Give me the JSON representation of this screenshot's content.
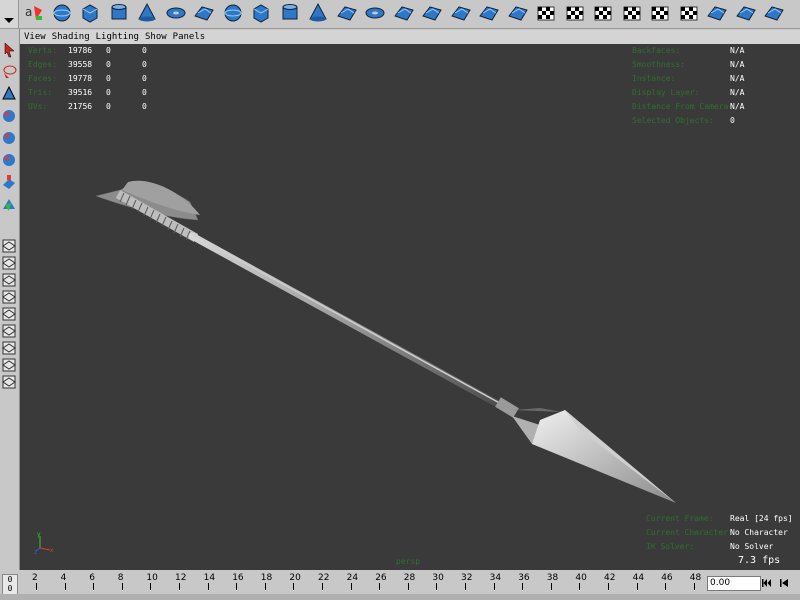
{
  "panel_menu": {
    "items": [
      "View",
      "Shading",
      "Lighting",
      "Show",
      "Panels"
    ]
  },
  "hud_left": [
    {
      "label": "Verts:",
      "v1": "19786",
      "v2": "0",
      "v3": "0"
    },
    {
      "label": "Edges:",
      "v1": "39558",
      "v2": "0",
      "v3": "0"
    },
    {
      "label": "Faces:",
      "v1": "19778",
      "v2": "0",
      "v3": "0"
    },
    {
      "label": "Tris:",
      "v1": "39516",
      "v2": "0",
      "v3": "0"
    },
    {
      "label": "UVs:",
      "v1": "21756",
      "v2": "0",
      "v3": "0"
    }
  ],
  "hud_right": [
    {
      "label": "Backfaces:",
      "value": "N/A"
    },
    {
      "label": "Smoothness:",
      "value": "N/A"
    },
    {
      "label": "Instance:",
      "value": "N/A"
    },
    {
      "label": "Display Layer:",
      "value": "N/A"
    },
    {
      "label": "Distance From Camera:",
      "value": "N/A"
    },
    {
      "label": "Selected Objects:",
      "value": "0"
    }
  ],
  "hud_bottom_right": [
    {
      "label": "Current Frame:",
      "value": "Real [24 fps]"
    },
    {
      "label": "Current Character:",
      "value": "No Character"
    },
    {
      "label": "IK Solver:",
      "value": "No Solver"
    }
  ],
  "fps_readout": "7.3 fps",
  "camera_name": "persp",
  "timeline": {
    "ticks": [
      "2",
      "4",
      "6",
      "8",
      "10",
      "12",
      "14",
      "16",
      "18",
      "20",
      "22",
      "24",
      "26",
      "28",
      "30",
      "32",
      "34",
      "36",
      "38",
      "40",
      "42",
      "44",
      "46",
      "48"
    ],
    "current_frame_top": "0",
    "current_frame_bottom": "0",
    "frame_field_value": "0.00"
  },
  "colors": {
    "viewport_bg": "#3a3a3a",
    "ui_gray": "#c8c8c8",
    "hud_value": "#ffffff",
    "hud_label": "#2f6f2f",
    "shelf_blue": "#2f78c8"
  },
  "shelf_icons": [
    "text-curve-icon",
    "sphere-icon",
    "cube-icon",
    "cylinder-icon",
    "cone-icon",
    "torus-icon",
    "plane-icon",
    "poly-sphere-icon",
    "poly-cube-icon",
    "poly-cylinder-icon",
    "poly-cone-icon",
    "poly-plane-icon",
    "poly-torus-icon",
    "subdiv-icon",
    "surface-icon",
    "surface-blue-icon",
    "surface-flat-icon",
    "uv-icon",
    "checker-icon",
    "checker-green-icon",
    "checker-red-icon",
    "checker-black-icon",
    "checker-white-icon",
    "checker-select-icon",
    "blue-surface-icon",
    "blue-flat-icon",
    "blue-panel-icon"
  ],
  "tool_icons": [
    "select-arrow-icon",
    "lasso-icon",
    "paint-select-icon",
    "move-icon",
    "rotate-icon",
    "scale-icon",
    "manipulator-icon",
    "last-tool-icon",
    "layout-single-icon",
    "layout-four-icon",
    "layout-side-icon",
    "layout-persp-icon",
    "layout-graph-icon",
    "layout-outliner-icon",
    "layout-hypershade-icon",
    "layout-render-icon",
    "layout-menu-icon"
  ]
}
